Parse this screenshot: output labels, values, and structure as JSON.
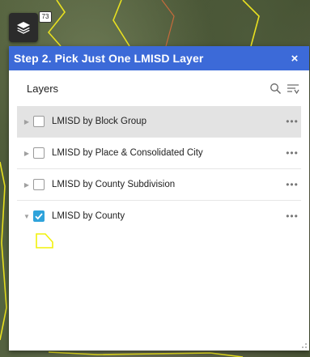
{
  "map": {
    "labels": {
      "top_center": "",
      "top_right": ""
    },
    "highway_shield": "73"
  },
  "toolbar": {
    "layers_button_icon": "layers-icon"
  },
  "panel": {
    "title": "Step 2. Pick Just One LMISD Layer",
    "close_label": "×",
    "header_color": "#3c6ad8"
  },
  "layers": {
    "title": "Layers",
    "icons": [
      "search-icon",
      "filter-icon"
    ],
    "items": [
      {
        "label": "LMISD by Block Group",
        "checked": false,
        "expanded": false,
        "highlighted": true,
        "more": "•••"
      },
      {
        "label": "LMISD by Place & Consolidated City",
        "checked": false,
        "expanded": false,
        "highlighted": false,
        "more": "•••"
      },
      {
        "label": "LMISD by County Subdivision",
        "checked": false,
        "expanded": false,
        "highlighted": false,
        "more": "•••"
      },
      {
        "label": "LMISD by County",
        "checked": true,
        "expanded": true,
        "highlighted": false,
        "more": "•••"
      }
    ],
    "legend_symbol_color": "#f2f20a",
    "checkbox_color": "#2fa3db"
  }
}
